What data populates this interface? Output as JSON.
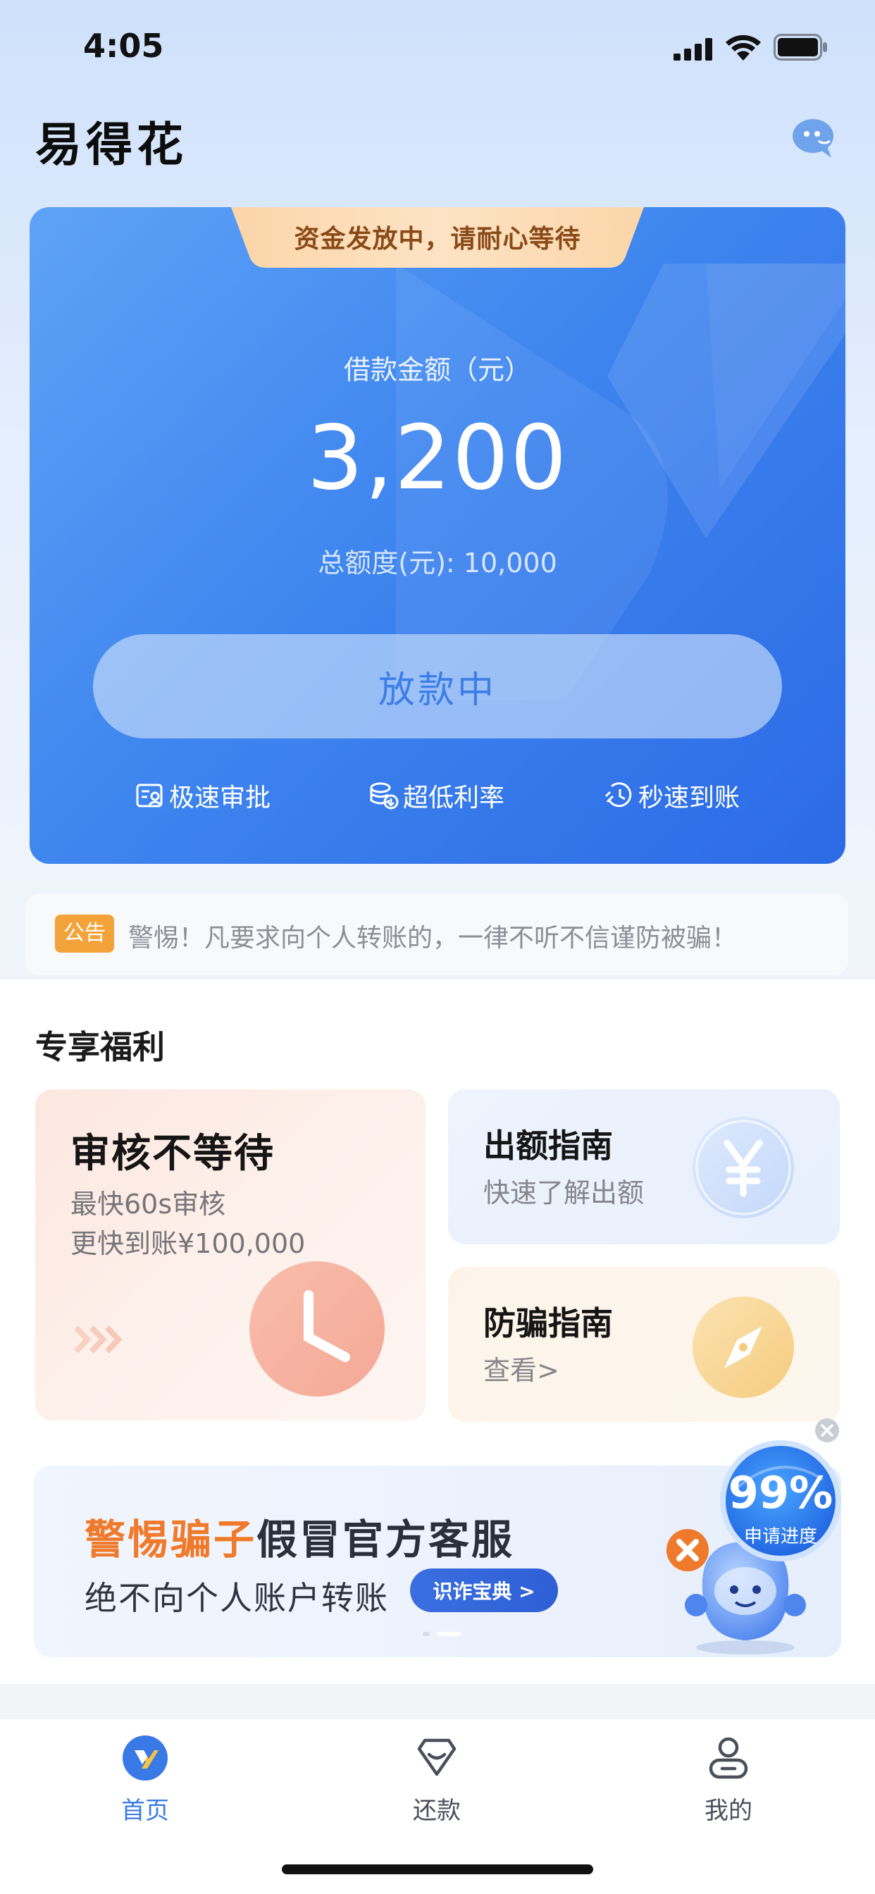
{
  "status_bar": {
    "time": "4:05"
  },
  "app": {
    "title": "易得花",
    "chat_icon": "customer-service-chat-icon"
  },
  "loan_card": {
    "banner": "资金发放中，请耐心等待",
    "amount_label": "借款金额（元）",
    "amount_value": "3,200",
    "total_quota": "总额度(元): 10,000",
    "status_button": "放款中",
    "features": [
      {
        "icon": "approval-icon",
        "label": "极速审批"
      },
      {
        "icon": "coins-icon",
        "label": "超低利率"
      },
      {
        "icon": "clock-fast-icon",
        "label": "秒速到账"
      }
    ]
  },
  "notice": {
    "tag": "公告",
    "text": "警惕！凡要求向个人转账的，一律不听不信谨防被骗！"
  },
  "benefits": {
    "title": "专享福利",
    "big_card": {
      "title": "审核不等待",
      "sub1": "最快60s审核",
      "sub2": "更快到账¥100,000",
      "icon": "clock-icon"
    },
    "quota_guide": {
      "title": "出额指南",
      "sub": "快速了解出额",
      "icon": "yuan-icon"
    },
    "fraud_guide": {
      "title": "防骗指南",
      "sub": "查看>",
      "icon": "compass-icon"
    }
  },
  "promo": {
    "highlight": "警惕骗子",
    "rest": "假冒官方客服",
    "line2": "绝不向个人账户转账",
    "button": "识诈宝典 >",
    "progress_pct": "99%",
    "progress_label": "申请进度"
  },
  "tabbar": {
    "items": [
      {
        "label": "首页",
        "active": true,
        "icon": "home-icon"
      },
      {
        "label": "还款",
        "active": false,
        "icon": "repay-icon"
      },
      {
        "label": "我的",
        "active": false,
        "icon": "profile-icon"
      }
    ]
  },
  "colors": {
    "primary": "#3f86ef",
    "accent_orange": "#f07a2b",
    "tab_active": "#3a7ae6"
  }
}
